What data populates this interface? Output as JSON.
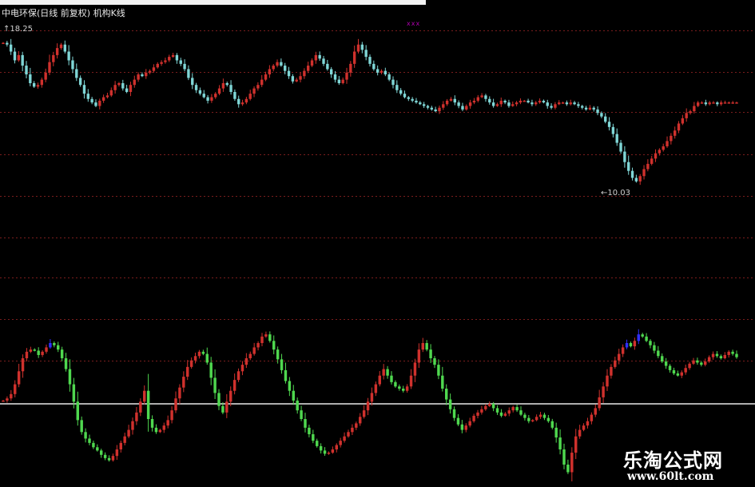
{
  "header": {
    "title": "中电环保(日线 前复权) 机构K线",
    "high_label": "18.25",
    "low_label": "10.03",
    "marker": "xxx"
  },
  "watermark": {
    "brand": "乐淘公式网",
    "url": "www.60lt.com"
  },
  "colors": {
    "background": "#000000",
    "up": "#d0312d",
    "down": "#7fd6d6",
    "osc_up": "#d0312d",
    "osc_down": "#4fd84f",
    "osc_peak": "#3030ff",
    "grid": "#7a1d1d",
    "zero_line": "#e8e8e8"
  },
  "chart_data": [
    {
      "type": "candlestick",
      "panel": "price",
      "title": "中电环保(日线 前复权) 机构K线",
      "ylim": [
        9.5,
        18.8
      ],
      "annotations": [
        {
          "label": "18.25",
          "kind": "high"
        },
        {
          "label": "10.03",
          "kind": "low"
        }
      ],
      "points": [
        18.0,
        17.9,
        17.5,
        17.0,
        17.3,
        16.7,
        16.2,
        15.7,
        15.5,
        15.6,
        15.9,
        16.3,
        16.9,
        17.3,
        17.7,
        17.9,
        17.5,
        17.0,
        16.5,
        16.0,
        15.6,
        15.1,
        14.8,
        14.6,
        14.4,
        14.7,
        14.9,
        15.0,
        15.3,
        15.6,
        15.7,
        15.4,
        15.2,
        15.6,
        15.9,
        16.2,
        16.1,
        16.3,
        16.4,
        16.6,
        16.8,
        16.9,
        17.0,
        17.2,
        17.3,
        17.0,
        16.8,
        16.5,
        16.0,
        15.6,
        15.3,
        15.1,
        14.9,
        14.7,
        14.9,
        15.1,
        15.4,
        15.7,
        15.6,
        15.2,
        14.8,
        14.5,
        14.6,
        14.8,
        15.1,
        15.4,
        15.6,
        15.9,
        16.2,
        16.5,
        16.7,
        16.9,
        16.7,
        16.4,
        16.1,
        15.8,
        15.9,
        16.1,
        16.4,
        16.7,
        17.0,
        17.3,
        17.1,
        16.8,
        16.5,
        16.2,
        15.9,
        15.7,
        15.9,
        16.3,
        16.8,
        17.5,
        17.9,
        17.6,
        17.2,
        16.8,
        16.5,
        16.3,
        16.4,
        16.2,
        15.9,
        15.6,
        15.3,
        15.1,
        14.9,
        14.8,
        14.7,
        14.6,
        14.5,
        14.4,
        14.3,
        14.2,
        14.1,
        14.3,
        14.5,
        14.7,
        14.8,
        14.6,
        14.4,
        14.2,
        14.4,
        14.6,
        14.7,
        14.9,
        15.0,
        14.8,
        14.6,
        14.4,
        14.5,
        14.7,
        14.6,
        14.4,
        14.5,
        14.6,
        14.7,
        14.7,
        14.6,
        14.5,
        14.6,
        14.7,
        14.6,
        14.4,
        14.3,
        14.5,
        14.6,
        14.6,
        14.5,
        14.6,
        14.5,
        14.4,
        14.3,
        14.2,
        14.3,
        14.2,
        14.0,
        13.8,
        13.5,
        13.2,
        12.8,
        12.3,
        11.8,
        11.2,
        10.7,
        10.3,
        10.1,
        10.4,
        10.8,
        11.1,
        11.4,
        11.7,
        11.9,
        12.1,
        12.4,
        12.7,
        13.0,
        13.4,
        13.7,
        14.0,
        14.1,
        14.4,
        14.6,
        14.6,
        14.5,
        14.6,
        14.6,
        14.5,
        14.6,
        14.6,
        14.6,
        14.6,
        14.6
      ]
    },
    {
      "type": "candlestick",
      "panel": "oscillator",
      "ylim": [
        -7,
        7
      ],
      "points": [
        0.3,
        0.5,
        0.9,
        1.8,
        3.0,
        4.2,
        4.8,
        5.0,
        4.9,
        4.5,
        4.8,
        5.2,
        5.6,
        5.4,
        5.0,
        4.2,
        3.2,
        1.8,
        0.2,
        -1.5,
        -2.6,
        -3.2,
        -3.6,
        -4.0,
        -4.3,
        -4.7,
        -5.0,
        -5.2,
        -4.8,
        -4.2,
        -3.6,
        -3.0,
        -2.4,
        -1.6,
        -0.8,
        0.2,
        1.2,
        -1.4,
        -2.2,
        -2.6,
        -2.4,
        -2.0,
        -1.5,
        -0.6,
        0.5,
        1.5,
        2.5,
        3.4,
        4.0,
        4.4,
        4.8,
        4.6,
        3.8,
        2.4,
        1.0,
        -0.2,
        -0.8,
        0.2,
        1.2,
        2.2,
        3.0,
        3.6,
        4.2,
        4.6,
        5.2,
        5.6,
        6.2,
        6.4,
        5.8,
        5.0,
        4.1,
        3.1,
        2.1,
        1.2,
        0.3,
        -0.6,
        -1.4,
        -2.2,
        -2.8,
        -3.4,
        -3.9,
        -4.3,
        -4.6,
        -4.5,
        -4.2,
        -3.8,
        -3.4,
        -3.0,
        -2.6,
        -2.2,
        -1.8,
        -1.2,
        -0.6,
        0.2,
        1.0,
        1.8,
        2.6,
        3.2,
        2.6,
        2.0,
        1.6,
        1.4,
        1.2,
        1.6,
        2.6,
        3.8,
        5.0,
        5.6,
        5.0,
        4.2,
        3.6,
        2.6,
        1.4,
        0.4,
        -0.5,
        -1.3,
        -1.9,
        -2.4,
        -2.0,
        -1.6,
        -1.1,
        -0.8,
        -0.5,
        -0.2,
        0.0,
        -0.4,
        -0.8,
        -1.1,
        -0.9,
        -0.6,
        -0.3,
        -0.6,
        -1.0,
        -1.3,
        -1.6,
        -1.5,
        -1.2,
        -1.0,
        -1.3,
        -1.6,
        -2.2,
        -3.1,
        -4.2,
        -5.6,
        -6.3,
        -4.5,
        -3.0,
        -2.4,
        -2.0,
        -1.6,
        -1.0,
        -0.4,
        0.6,
        1.6,
        2.6,
        3.4,
        4.0,
        4.6,
        5.2,
        5.6,
        5.3,
        5.8,
        6.4,
        6.2,
        5.8,
        5.4,
        4.9,
        4.4,
        3.9,
        3.5,
        3.1,
        2.8,
        2.6,
        2.9,
        3.3,
        3.7,
        4.0,
        3.8,
        3.6,
        3.9,
        4.3,
        4.6,
        4.4,
        4.2,
        4.5,
        4.8,
        4.6,
        4.3
      ]
    }
  ]
}
